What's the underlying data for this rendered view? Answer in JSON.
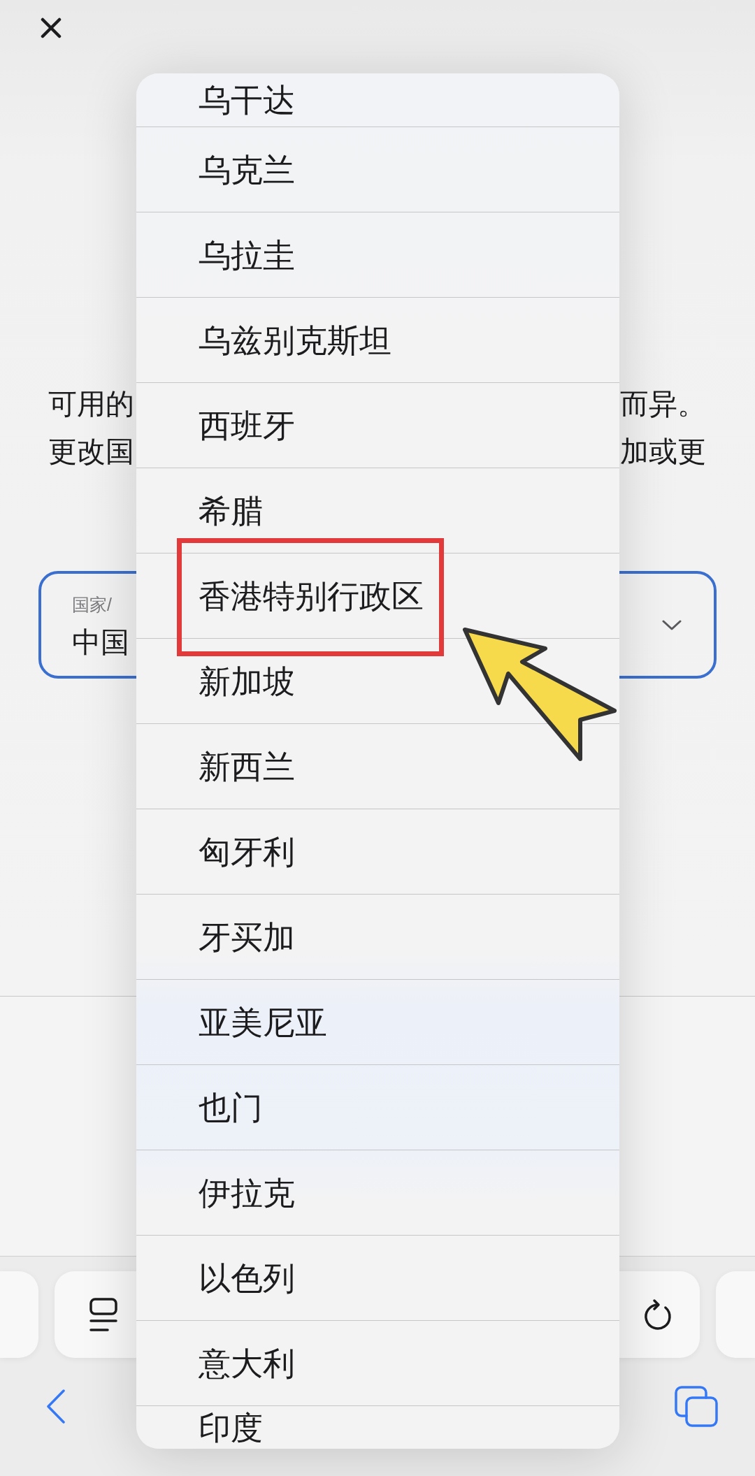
{
  "description": {
    "lines": [
      {
        "start": "可用的",
        "end": "而异。"
      },
      {
        "start": "更改国",
        "end": "加或更"
      }
    ]
  },
  "country_field": {
    "label": "国家/",
    "value": "中国"
  },
  "country_menu": {
    "items": [
      {
        "label": "乌干达",
        "annotated": false
      },
      {
        "label": "乌克兰",
        "annotated": false
      },
      {
        "label": "乌拉圭",
        "annotated": false
      },
      {
        "label": "乌兹别克斯坦",
        "annotated": false
      },
      {
        "label": "西班牙",
        "annotated": false
      },
      {
        "label": "希腊",
        "annotated": false
      },
      {
        "label": "香港特别行政区",
        "annotated": true
      },
      {
        "label": "新加坡",
        "annotated": false
      },
      {
        "label": "新西兰",
        "annotated": false
      },
      {
        "label": "匈牙利",
        "annotated": false
      },
      {
        "label": "牙买加",
        "annotated": false
      },
      {
        "label": "亚美尼亚",
        "annotated": false
      },
      {
        "label": "也门",
        "annotated": false
      },
      {
        "label": "伊拉克",
        "annotated": false
      },
      {
        "label": "以色列",
        "annotated": false
      },
      {
        "label": "意大利",
        "annotated": false
      },
      {
        "label": "印度",
        "annotated": false
      }
    ]
  }
}
